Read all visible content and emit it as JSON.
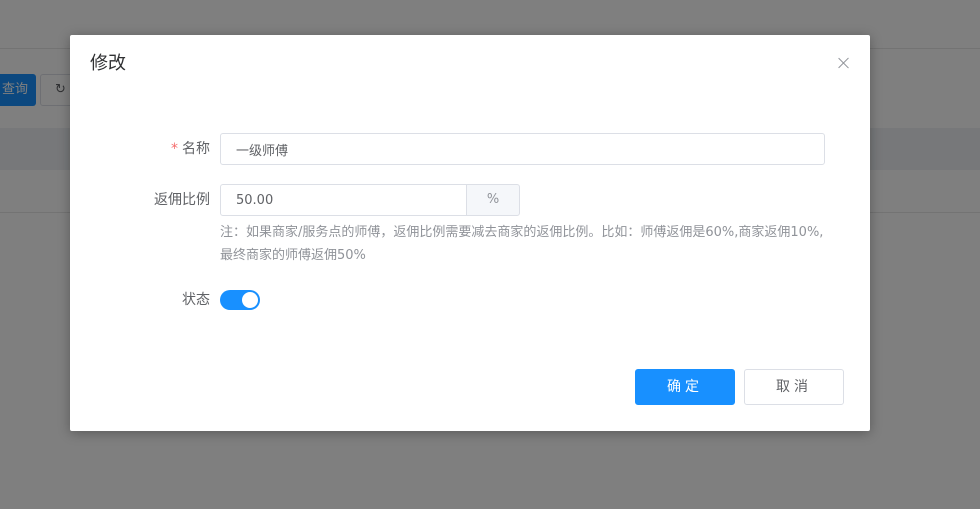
{
  "background": {
    "query_button_label": "查询",
    "reset_icon": "refresh-icon",
    "reset_glyph": "↻"
  },
  "dialog": {
    "title": "修改",
    "close_icon": "close-icon",
    "form": {
      "name": {
        "label": "名称",
        "required": true,
        "value": "一级师傅"
      },
      "commission_rate": {
        "label": "返佣比例",
        "value": "50.00",
        "suffix": "%",
        "note": "注：如果商家/服务点的师傅，返佣比例需要减去商家的返佣比例。比如：师傅返佣是60%,商家返佣10%,最终商家的师傅返佣50%"
      },
      "status": {
        "label": "状态",
        "enabled": true
      }
    },
    "footer": {
      "confirm_label": "确定",
      "cancel_label": "取消"
    }
  },
  "colors": {
    "primary": "#1890ff",
    "required": "#f56c6c",
    "mask": "rgba(0,0,0,0.5)"
  }
}
